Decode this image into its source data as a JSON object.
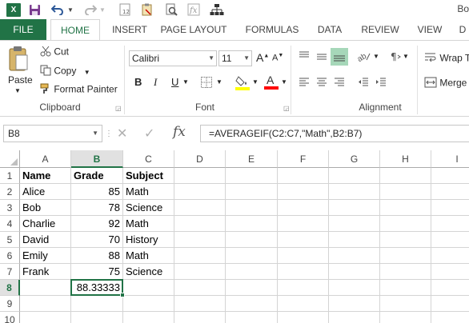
{
  "qat": {
    "undo_icon": "undo-icon",
    "redo_icon": "redo-icon",
    "right_text": "Bo"
  },
  "tabs": [
    "FILE",
    "HOME",
    "INSERT",
    "PAGE LAYOUT",
    "FORMULAS",
    "DATA",
    "REVIEW",
    "VIEW",
    "D"
  ],
  "ribbon": {
    "clipboard": {
      "paste": "Paste",
      "cut": "Cut",
      "copy": "Copy",
      "format_painter": "Format Painter",
      "label": "Clipboard"
    },
    "font": {
      "font_name": "Calibri",
      "font_size": "11",
      "bold": "B",
      "italic": "I",
      "underline": "U",
      "label": "Font",
      "fill_color": "#ffff00",
      "font_color": "#ff0000"
    },
    "alignment": {
      "wrap_text": "Wrap T",
      "merge": "Merge",
      "label": "Alignment"
    }
  },
  "formula_bar": {
    "name_box": "B8",
    "cancel": "✕",
    "enter": "✓",
    "fx": "fx",
    "formula": "=AVERAGEIF(C2:C7,\"Math\",B2:B7)"
  },
  "sheet": {
    "columns": [
      "A",
      "B",
      "C",
      "D",
      "E",
      "F",
      "G",
      "H",
      "I"
    ],
    "selected_column": "B",
    "rows": [
      "1",
      "2",
      "3",
      "4",
      "5",
      "6",
      "7",
      "8",
      "9",
      "10"
    ],
    "selected_row": "8",
    "header": [
      "Name",
      "Grade",
      "Subject"
    ],
    "data": [
      [
        "Alice",
        "85",
        "Math"
      ],
      [
        "Bob",
        "78",
        "Science"
      ],
      [
        "Charlie",
        "92",
        "Math"
      ],
      [
        "David",
        "70",
        "History"
      ],
      [
        "Emily",
        "88",
        "Math"
      ],
      [
        "Frank",
        "75",
        "Science"
      ]
    ],
    "result": "88.33333",
    "accent": "#217346"
  }
}
